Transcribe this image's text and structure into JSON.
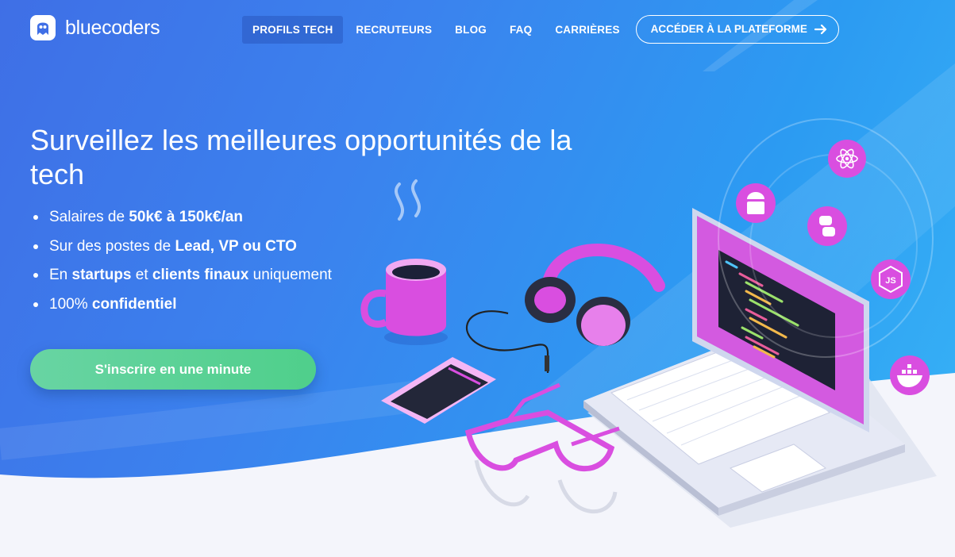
{
  "brand": {
    "name": "bluecoders"
  },
  "nav": {
    "items": [
      {
        "label": "PROFILS TECH",
        "active": true
      },
      {
        "label": "RECRUTEURS",
        "active": false
      },
      {
        "label": "BLOG",
        "active": false
      },
      {
        "label": "FAQ",
        "active": false
      },
      {
        "label": "CARRIÈRES",
        "active": false
      }
    ],
    "platform_button": "ACCÉDER À LA PLATEFORME"
  },
  "hero": {
    "headline": "Surveillez les meilleures opportunités de la tech",
    "bullets": [
      {
        "text": "Salaires de",
        "strong": "50k€ à 150k€/an"
      },
      {
        "text": "Sur des postes de",
        "strong": "Lead, VP ou CTO"
      },
      {
        "prefix": "En",
        "strong1": "startups",
        "mid": "et",
        "strong2": "clients finaux",
        "suffix": "uniquement"
      },
      {
        "text": "100%",
        "strong": "confidentiel"
      }
    ],
    "cta": "S'inscrire en une minute"
  },
  "illustration": {
    "tech_icons": [
      "react-icon",
      "android-icon",
      "python-icon",
      "nodejs-icon",
      "docker-icon"
    ]
  },
  "colors": {
    "hero_start": "#3f6fe6",
    "hero_end": "#38b4f6",
    "cta_green": "#4fcf8b",
    "accent_pink": "#d94ee0",
    "page_bg": "#f4f5fb"
  }
}
